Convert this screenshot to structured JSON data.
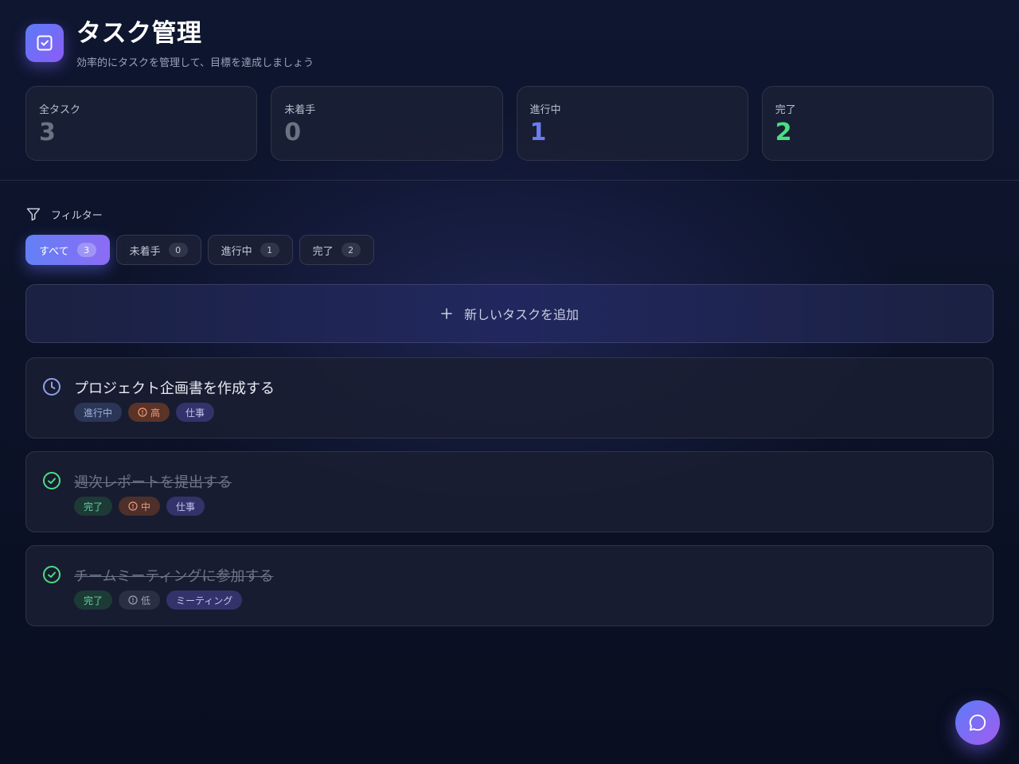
{
  "header": {
    "title": "タスク管理",
    "subtitle": "効率的にタスクを管理して、目標を達成しましょう",
    "icon": "check-square-icon"
  },
  "stats": [
    {
      "label": "全タスク",
      "value": "3"
    },
    {
      "label": "未着手",
      "value": "0"
    },
    {
      "label": "進行中",
      "value": "1"
    },
    {
      "label": "完了",
      "value": "2"
    }
  ],
  "filter": {
    "heading": "フィルター",
    "tabs": [
      {
        "label": "すべて",
        "count": "3",
        "active": true
      },
      {
        "label": "未着手",
        "count": "0",
        "active": false
      },
      {
        "label": "進行中",
        "count": "1",
        "active": false
      },
      {
        "label": "完了",
        "count": "2",
        "active": false
      }
    ]
  },
  "add_task_label": "新しいタスクを追加",
  "tasks": [
    {
      "title": "プロジェクト企画書を作成する",
      "status": "進行中",
      "priority": "高",
      "category": "仕事",
      "status_icon": "clock-icon"
    },
    {
      "title": "週次レポートを提出する",
      "status": "完了",
      "priority": "中",
      "category": "仕事",
      "status_icon": "check-circle-icon"
    },
    {
      "title": "チームミーティングに参加する",
      "status": "完了",
      "priority": "低",
      "category": "ミーティング",
      "status_icon": "check-circle-icon"
    }
  ],
  "colors": {
    "accent": "#6380f5",
    "accent_purple": "#8b5cf6",
    "in_progress": "#6b7cf0",
    "done": "#4ade80"
  }
}
